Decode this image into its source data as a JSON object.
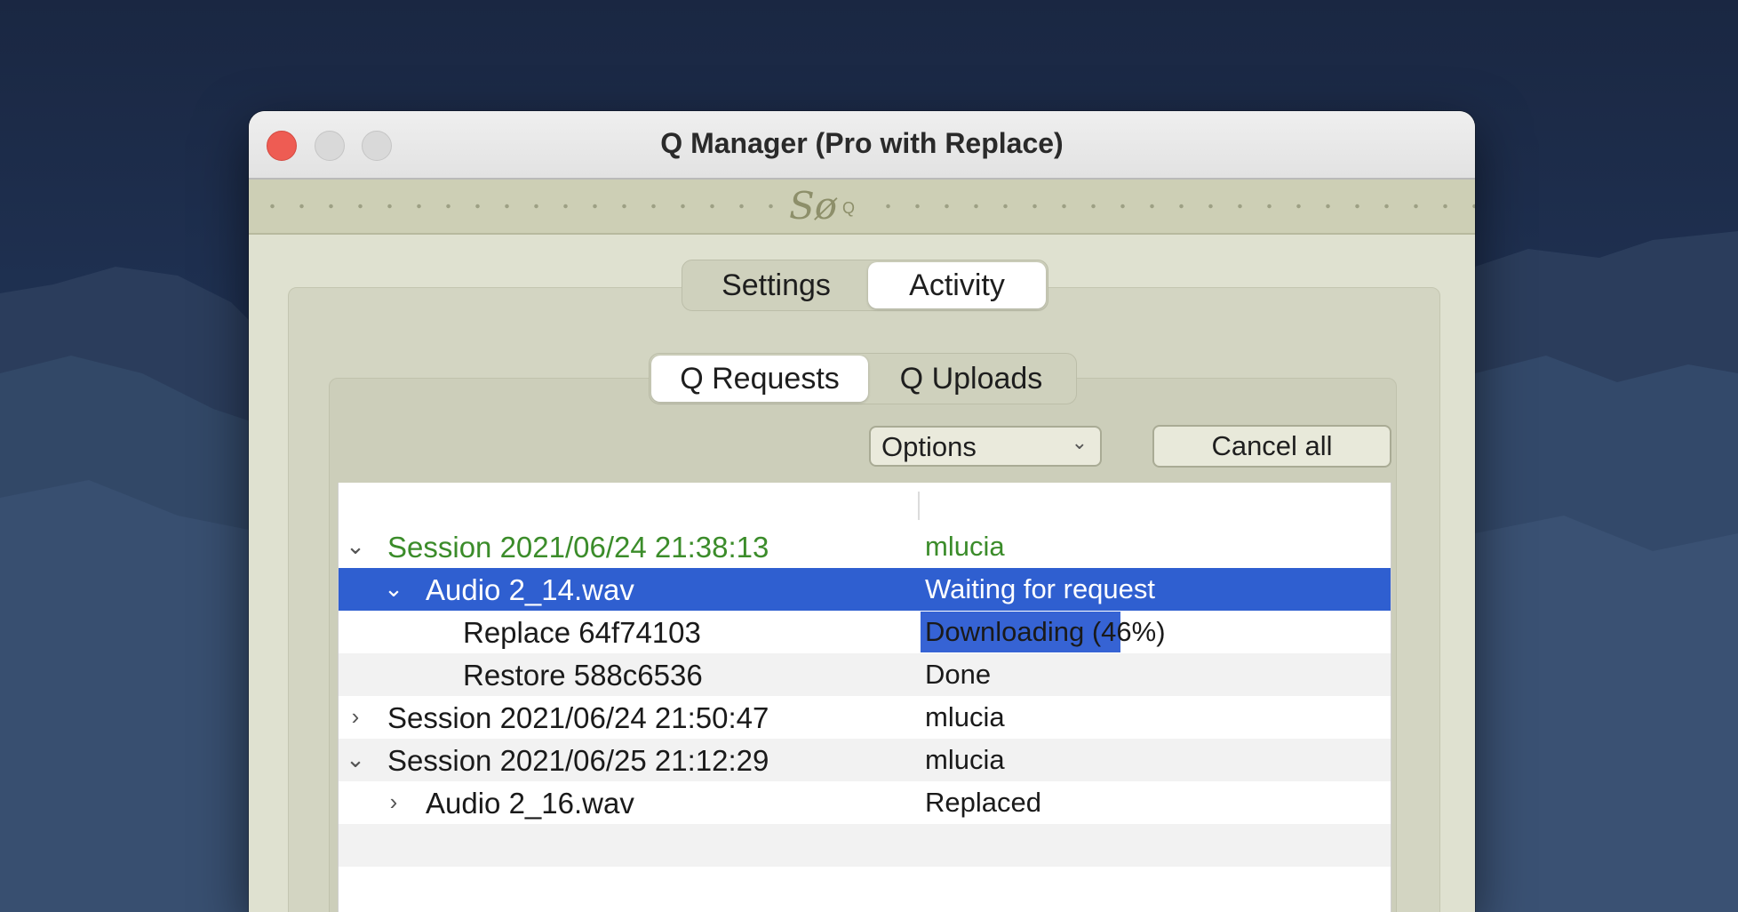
{
  "window": {
    "title": "Q Manager (Pro with Replace)",
    "logo": "Sø",
    "logo_suffix": "Q"
  },
  "tabs": {
    "main": [
      {
        "label": "Settings",
        "active": false
      },
      {
        "label": "Activity",
        "active": true
      }
    ],
    "sub": [
      {
        "label": "Q Requests",
        "active": true
      },
      {
        "label": "Q Uploads",
        "active": false
      }
    ]
  },
  "toolbar": {
    "options_label": "Options",
    "cancel_all_label": "Cancel all"
  },
  "list": {
    "rows": [
      {
        "name": "Session 2021/06/24 21:38:13",
        "status": "mlucia",
        "expanded": true
      },
      {
        "name": "Audio 2_14.wav",
        "status": "Waiting for request",
        "expanded": true
      },
      {
        "name": "Replace 64f74103",
        "status": "Downloading (46%)",
        "progress": 0.46
      },
      {
        "name": "Restore 588c6536",
        "status": "Done"
      },
      {
        "name": "Session 2021/06/24 21:50:47",
        "status": "mlucia",
        "expanded": false
      },
      {
        "name": "Session 2021/06/25 21:12:29",
        "status": "mlucia",
        "expanded": true
      },
      {
        "name": "Audio 2_16.wav",
        "status": "Replaced",
        "expanded": false
      }
    ]
  },
  "colors": {
    "session_highlight": "#3b8c2a",
    "selection": "#2f5fd0",
    "progress": "#3663d4"
  }
}
